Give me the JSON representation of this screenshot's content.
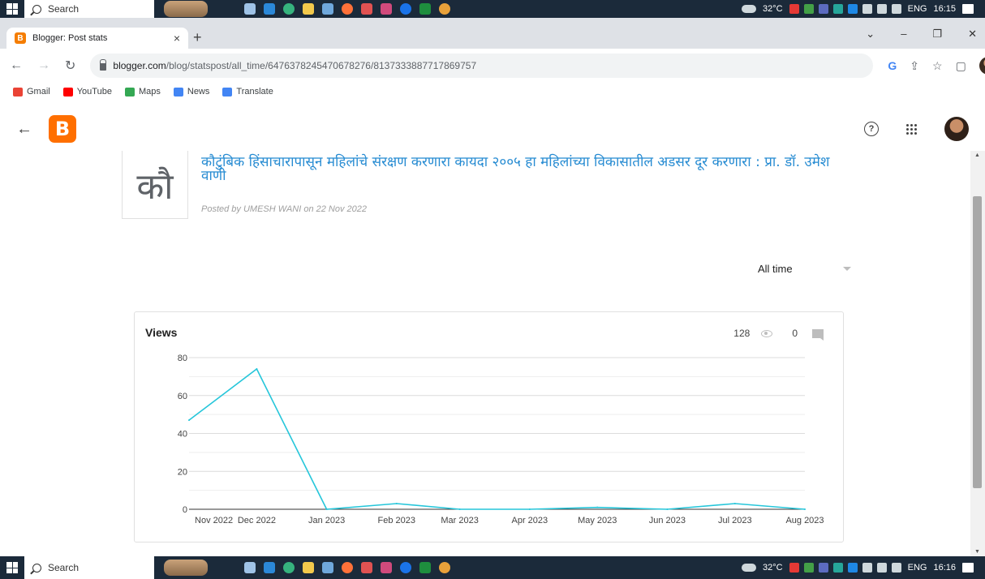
{
  "taskbar": {
    "search_label": "Search",
    "weather": "32°C",
    "language": "ENG",
    "time_top": "16:15",
    "time_bottom": "16:16"
  },
  "browser": {
    "tab_title": "Blogger: Post stats",
    "url_host": "blogger.com",
    "url_path": "/blog/statspost/all_time/6476378245470678276/8137333887717869757",
    "bookmarks": [
      "Gmail",
      "YouTube",
      "Maps",
      "News",
      "Translate"
    ]
  },
  "colors": {
    "accent": "#26c6da",
    "blogger_orange": "#ff6f00",
    "title_blue": "#268bd2"
  },
  "post": {
    "thumb_text": "कौ",
    "title": "कौटुंबिक हिंसाचारापासून महिलांचे संरक्षण करणारा कायदा २००५ हा महिलांच्या विकासातील अडसर दूर करणारा : प्रा. डॉ. उमेश वाणी",
    "meta": "Posted by UMESH WANI on 22 Nov 2022"
  },
  "range": {
    "selected": "All time"
  },
  "views_card": {
    "title": "Views",
    "views_count": "128",
    "comments_count": "0"
  },
  "chart_data": {
    "type": "line",
    "title": "Views",
    "x": [
      "Nov 2022",
      "Dec 2022",
      "Jan 2023",
      "Feb 2023",
      "Mar 2023",
      "Apr 2023",
      "May 2023",
      "Jun 2023",
      "Jul 2023",
      "Aug 2023"
    ],
    "x_positions_days": [
      0,
      19,
      50,
      81,
      109,
      140,
      170,
      201,
      231,
      262
    ],
    "series": [
      {
        "values_x_days": [
          -11,
          19,
          50,
          81,
          109,
          140,
          170,
          201,
          231,
          262
        ],
        "values": [
          47,
          74,
          0,
          3,
          0,
          0,
          1,
          0,
          3,
          0
        ]
      }
    ],
    "yticks": [
      0,
      20,
      40,
      60,
      80
    ],
    "ylim": [
      0,
      80
    ],
    "grid": true
  }
}
